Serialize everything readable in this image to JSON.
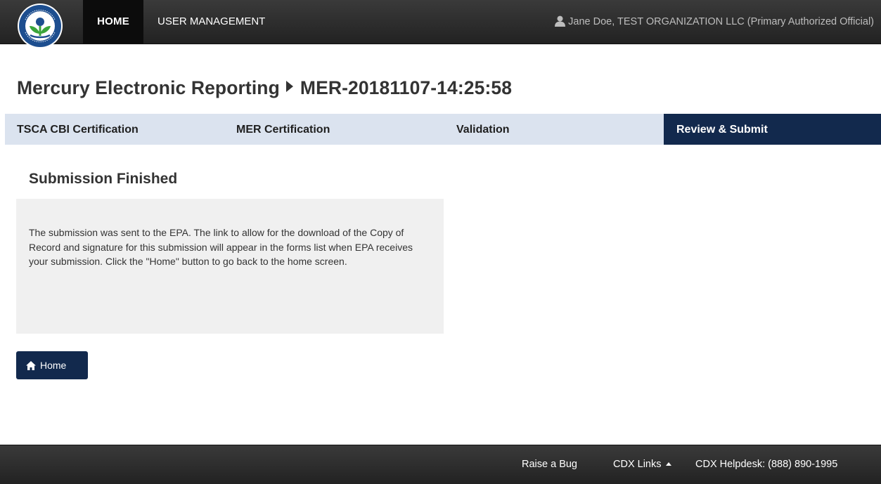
{
  "navbar": {
    "logo_icon": "epa-seal-icon",
    "home_label": "HOME",
    "user_management_label": "USER MANAGEMENT",
    "user_icon": "user-icon",
    "user_text": "Jane Doe, TEST ORGANIZATION LLC (Primary Authorized Official)"
  },
  "header": {
    "app_name": "Mercury Electronic Reporting",
    "submission_id": "MER-20181107-14:25:58"
  },
  "steps": [
    {
      "label": "TSCA CBI Certification",
      "active": false
    },
    {
      "label": "MER Certification",
      "active": false
    },
    {
      "label": "Validation",
      "active": false
    },
    {
      "label": "Review & Submit",
      "active": true
    }
  ],
  "content": {
    "section_title": "Submission Finished",
    "message": "The submission was sent to the EPA. The link to allow for the download of the Copy of Record and signature for this submission will appear in the forms list when EPA receives your submission. Click the \"Home\" button to go back to the home screen.",
    "home_button_label": "Home",
    "home_button_icon": "home-icon"
  },
  "footer": {
    "raise_bug_label": "Raise a Bug",
    "cdx_links_label": "CDX Links",
    "helpdesk_label": "CDX Helpdesk: (888) 890-1995"
  },
  "colors": {
    "navbar_bg": "#2b2b2b",
    "active_nav_bg": "#0c0c0c",
    "steps_bg": "#dbe3ef",
    "active_step_bg": "#12294d",
    "message_box_bg": "#f0f0f0",
    "button_bg": "#12294d"
  }
}
